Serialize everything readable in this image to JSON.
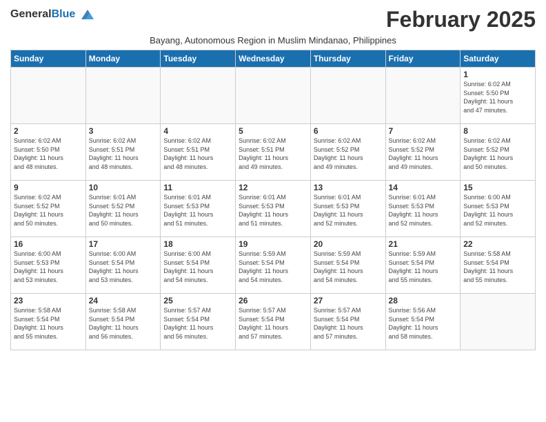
{
  "header": {
    "logo_general": "General",
    "logo_blue": "Blue",
    "month_title": "February 2025",
    "subtitle": "Bayang, Autonomous Region in Muslim Mindanao, Philippines"
  },
  "weekdays": [
    "Sunday",
    "Monday",
    "Tuesday",
    "Wednesday",
    "Thursday",
    "Friday",
    "Saturday"
  ],
  "weeks": [
    [
      {
        "day": "",
        "info": ""
      },
      {
        "day": "",
        "info": ""
      },
      {
        "day": "",
        "info": ""
      },
      {
        "day": "",
        "info": ""
      },
      {
        "day": "",
        "info": ""
      },
      {
        "day": "",
        "info": ""
      },
      {
        "day": "1",
        "info": "Sunrise: 6:02 AM\nSunset: 5:50 PM\nDaylight: 11 hours\nand 47 minutes."
      }
    ],
    [
      {
        "day": "2",
        "info": "Sunrise: 6:02 AM\nSunset: 5:50 PM\nDaylight: 11 hours\nand 48 minutes."
      },
      {
        "day": "3",
        "info": "Sunrise: 6:02 AM\nSunset: 5:51 PM\nDaylight: 11 hours\nand 48 minutes."
      },
      {
        "day": "4",
        "info": "Sunrise: 6:02 AM\nSunset: 5:51 PM\nDaylight: 11 hours\nand 48 minutes."
      },
      {
        "day": "5",
        "info": "Sunrise: 6:02 AM\nSunset: 5:51 PM\nDaylight: 11 hours\nand 49 minutes."
      },
      {
        "day": "6",
        "info": "Sunrise: 6:02 AM\nSunset: 5:52 PM\nDaylight: 11 hours\nand 49 minutes."
      },
      {
        "day": "7",
        "info": "Sunrise: 6:02 AM\nSunset: 5:52 PM\nDaylight: 11 hours\nand 49 minutes."
      },
      {
        "day": "8",
        "info": "Sunrise: 6:02 AM\nSunset: 5:52 PM\nDaylight: 11 hours\nand 50 minutes."
      }
    ],
    [
      {
        "day": "9",
        "info": "Sunrise: 6:02 AM\nSunset: 5:52 PM\nDaylight: 11 hours\nand 50 minutes."
      },
      {
        "day": "10",
        "info": "Sunrise: 6:01 AM\nSunset: 5:52 PM\nDaylight: 11 hours\nand 50 minutes."
      },
      {
        "day": "11",
        "info": "Sunrise: 6:01 AM\nSunset: 5:53 PM\nDaylight: 11 hours\nand 51 minutes."
      },
      {
        "day": "12",
        "info": "Sunrise: 6:01 AM\nSunset: 5:53 PM\nDaylight: 11 hours\nand 51 minutes."
      },
      {
        "day": "13",
        "info": "Sunrise: 6:01 AM\nSunset: 5:53 PM\nDaylight: 11 hours\nand 52 minutes."
      },
      {
        "day": "14",
        "info": "Sunrise: 6:01 AM\nSunset: 5:53 PM\nDaylight: 11 hours\nand 52 minutes."
      },
      {
        "day": "15",
        "info": "Sunrise: 6:00 AM\nSunset: 5:53 PM\nDaylight: 11 hours\nand 52 minutes."
      }
    ],
    [
      {
        "day": "16",
        "info": "Sunrise: 6:00 AM\nSunset: 5:53 PM\nDaylight: 11 hours\nand 53 minutes."
      },
      {
        "day": "17",
        "info": "Sunrise: 6:00 AM\nSunset: 5:54 PM\nDaylight: 11 hours\nand 53 minutes."
      },
      {
        "day": "18",
        "info": "Sunrise: 6:00 AM\nSunset: 5:54 PM\nDaylight: 11 hours\nand 54 minutes."
      },
      {
        "day": "19",
        "info": "Sunrise: 5:59 AM\nSunset: 5:54 PM\nDaylight: 11 hours\nand 54 minutes."
      },
      {
        "day": "20",
        "info": "Sunrise: 5:59 AM\nSunset: 5:54 PM\nDaylight: 11 hours\nand 54 minutes."
      },
      {
        "day": "21",
        "info": "Sunrise: 5:59 AM\nSunset: 5:54 PM\nDaylight: 11 hours\nand 55 minutes."
      },
      {
        "day": "22",
        "info": "Sunrise: 5:58 AM\nSunset: 5:54 PM\nDaylight: 11 hours\nand 55 minutes."
      }
    ],
    [
      {
        "day": "23",
        "info": "Sunrise: 5:58 AM\nSunset: 5:54 PM\nDaylight: 11 hours\nand 55 minutes."
      },
      {
        "day": "24",
        "info": "Sunrise: 5:58 AM\nSunset: 5:54 PM\nDaylight: 11 hours\nand 56 minutes."
      },
      {
        "day": "25",
        "info": "Sunrise: 5:57 AM\nSunset: 5:54 PM\nDaylight: 11 hours\nand 56 minutes."
      },
      {
        "day": "26",
        "info": "Sunrise: 5:57 AM\nSunset: 5:54 PM\nDaylight: 11 hours\nand 57 minutes."
      },
      {
        "day": "27",
        "info": "Sunrise: 5:57 AM\nSunset: 5:54 PM\nDaylight: 11 hours\nand 57 minutes."
      },
      {
        "day": "28",
        "info": "Sunrise: 5:56 AM\nSunset: 5:54 PM\nDaylight: 11 hours\nand 58 minutes."
      },
      {
        "day": "",
        "info": ""
      }
    ]
  ]
}
